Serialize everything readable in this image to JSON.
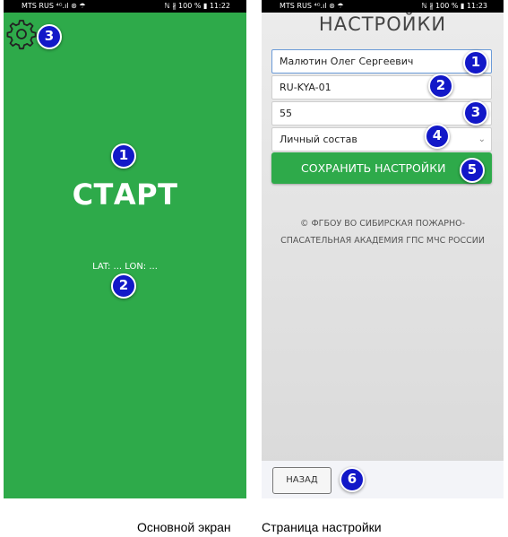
{
  "main_screen": {
    "status_bar": {
      "carrier": "MTS RUS ⁴ᴳ.ıl ⊛ ☂",
      "right": "ℕ ∦ 100 % ▮ 11:22"
    },
    "start_label": "СТАРТ",
    "coords_label": "LAT: ... LON: ...",
    "settings_icon": "gear-icon",
    "background_color": "#2eaa4a",
    "markers": [
      "1",
      "2",
      "3"
    ]
  },
  "settings_screen": {
    "status_bar": {
      "carrier": "MTS RUS ⁴ᴳ.ıl ⊛ ☂",
      "right": "ℕ ∦ 100 % ▮ 11:23"
    },
    "title": "НАСТРОЙКИ",
    "fields": {
      "name": "Малютин Олег Сергеевич",
      "code": "RU-KYA-01",
      "number": "55"
    },
    "select_value": "Личный состав",
    "save_label": "СОХРАНИТЬ НАСТРОЙКИ",
    "copyright": "© ФГБОУ ВО СИБИРСКАЯ ПОЖАРНО-СПАСАТЕЛЬНАЯ АКАДЕМИЯ ГПС МЧС РОССИИ",
    "back_label": "НАЗАД",
    "accent_color": "#2eaa4a",
    "markers": [
      "1",
      "2",
      "3",
      "4",
      "5",
      "6"
    ]
  },
  "captions": {
    "left": "Основной экран",
    "right": "Страница настройки"
  }
}
